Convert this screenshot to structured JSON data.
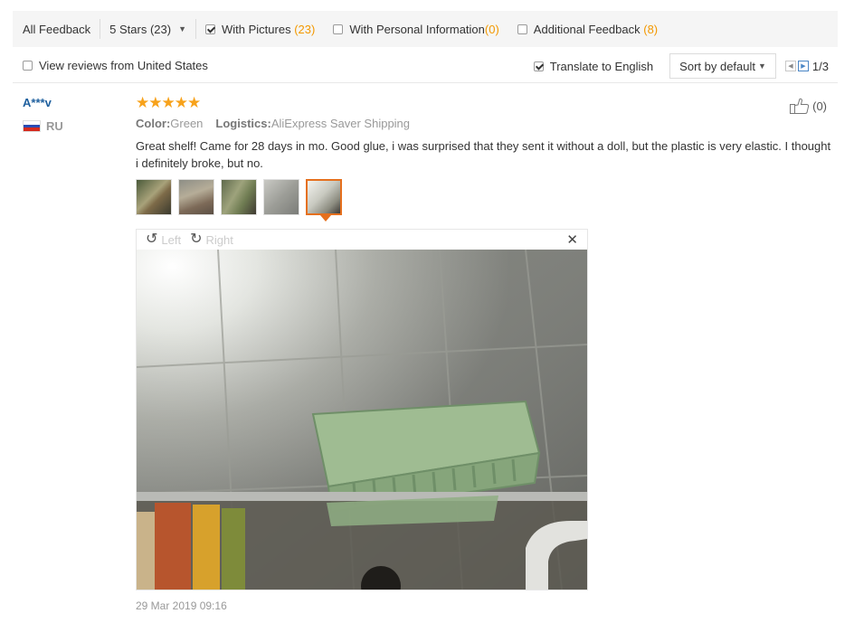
{
  "filters": {
    "all_feedback": "All Feedback",
    "stars_select": "5 Stars (23)",
    "with_pictures": {
      "label": "With Pictures",
      "count": "(23)",
      "checked": true
    },
    "with_personal_info": {
      "label": "With Personal Information",
      "count": "(0)",
      "checked": false
    },
    "additional_feedback": {
      "label": "Additional Feedback",
      "count": "(8)",
      "checked": false
    }
  },
  "options": {
    "view_us": {
      "label": "View reviews from United States",
      "checked": false
    },
    "translate": {
      "label": "Translate to English",
      "checked": true
    },
    "sort": "Sort by default",
    "pagination": "1/3"
  },
  "review": {
    "author": "A***v",
    "country": "RU",
    "rating": 5,
    "helpful_count": "(0)",
    "color_label": "Color:",
    "color_value": "Green",
    "logistics_label": "Logistics:",
    "logistics_value": "AliExpress Saver Shipping",
    "text": "Great shelf! Came for 28 days in mo. Good glue, i was surprised that they sent it without a doll, but the plastic is very elastic. I thought i definitely broke, but no.",
    "date": "29 Mar 2019 09:16"
  },
  "viewer": {
    "rotate_left": "Left",
    "rotate_right": "Right"
  },
  "colors": {
    "accent_orange": "#f39800",
    "star": "#f7a21b",
    "author_blue": "#1e5f9e",
    "active_thumb_border": "#e5701e"
  }
}
